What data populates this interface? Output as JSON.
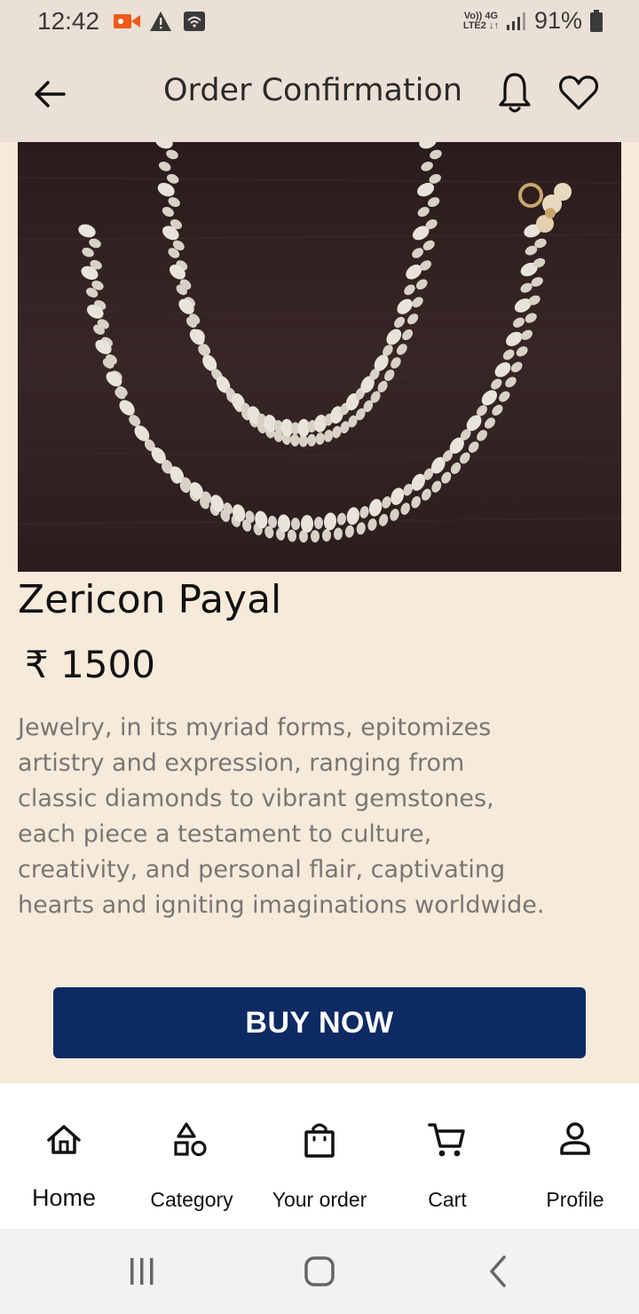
{
  "status_bar": {
    "time": "12:42",
    "network_top": "Vo)) 4G",
    "network_bottom": "LTE2 ↓↑",
    "battery": "91%"
  },
  "header": {
    "title": "Order Confirmation",
    "icons": [
      "back-arrow-icon",
      "bell-icon",
      "heart-icon"
    ]
  },
  "product": {
    "name": "Zericon Payal",
    "price": "₹ 1500",
    "description": "Jewelry, in its myriad forms, epitomizes artistry and expression, ranging from classic diamonds to vibrant gemstones, each piece a testament to culture, creativity, and personal flair, captivating hearts and igniting imaginations worldwide."
  },
  "actions": {
    "buy_label": "BUY NOW"
  },
  "bottom_nav": {
    "items": [
      {
        "label": "Home",
        "icon": "home-icon"
      },
      {
        "label": "Category",
        "icon": "category-icon"
      },
      {
        "label": "Your order",
        "icon": "bag-icon"
      },
      {
        "label": "Cart",
        "icon": "cart-icon"
      },
      {
        "label": "Profile",
        "icon": "profile-icon"
      }
    ]
  },
  "colors": {
    "background": "#f6eadb",
    "app_bar": "#ebe0d5",
    "buy_button": "#0d2a63"
  }
}
